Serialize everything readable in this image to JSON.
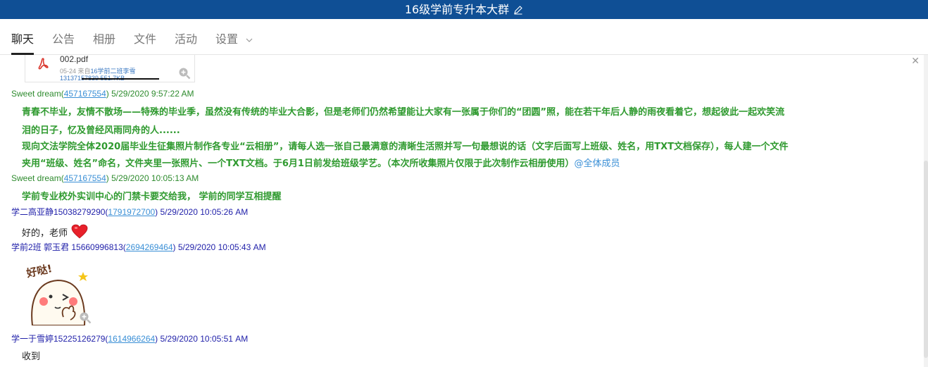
{
  "window": {
    "title": "16级学前专升本大群"
  },
  "tabs": [
    {
      "label": "聊天",
      "active": true
    },
    {
      "label": "公告"
    },
    {
      "label": "相册"
    },
    {
      "label": "文件"
    },
    {
      "label": "活动"
    },
    {
      "label": "设置"
    }
  ],
  "file": {
    "name": "002.pdf",
    "date": "05-24 来自",
    "from": "16学前二班李雪",
    "extra": "13137157839 551.7KB"
  },
  "messages": [
    {
      "name": "Sweet  dream(",
      "qq": "457167554",
      "close": ")",
      "time": " 5/29/2020 9:57:22 AM",
      "lines": [
        "青春不毕业，友情不散场——特殊的毕业季，虽然没有传统的毕业大合影，但是老师们仍然希望能让大家有一张属于你们的“团圆”照，能在若干年后人静的雨夜看着它，想起彼此一起欢笑流",
        "泪的日子，忆及曾经风雨同舟的人......",
        "现向文法学院全体2020届毕业生征集照片制作各专业“云相册”，请每人选一张自己最满意的清晰生活照并写一句最想说的话（文字后面写上班级、姓名，用TXT文档保存），每人建一个文件",
        "夹用“班级、姓名”命名，文件夹里一张照片、一个TXT文档。于6月1日前发给班级学艺。（本次所收集照片仅限于此次制作云相册使用）"
      ],
      "mention": "@全体成员"
    },
    {
      "name": "Sweet  dream(",
      "qq": "457167554",
      "close": ")",
      "time": " 5/29/2020 10:05:13 AM",
      "text": "学前专业校外实训中心的门禁卡要交给我， 学前的同学互相提醒"
    },
    {
      "name": "学二高亚静15038279290(",
      "qq": "1791972700",
      "close": ")",
      "time": " 5/29/2020 10:05:26 AM",
      "text": "好的，老师"
    },
    {
      "name": "学前2班 郭玉君 15660996813(",
      "qq": "2694269464",
      "close": ")",
      "time": " 5/29/2020 10:05:43 AM",
      "sticker_text": "好哒!"
    },
    {
      "name": "学一于雪婷15225126279(",
      "qq": "1614966264",
      "close": ")",
      "time": " 5/29/2020 10:05:51 AM",
      "text": "收到"
    }
  ],
  "colors": {
    "titlebar": "#0f4f95",
    "green_text": "#2f9a2f",
    "link": "#3a8fd6"
  }
}
